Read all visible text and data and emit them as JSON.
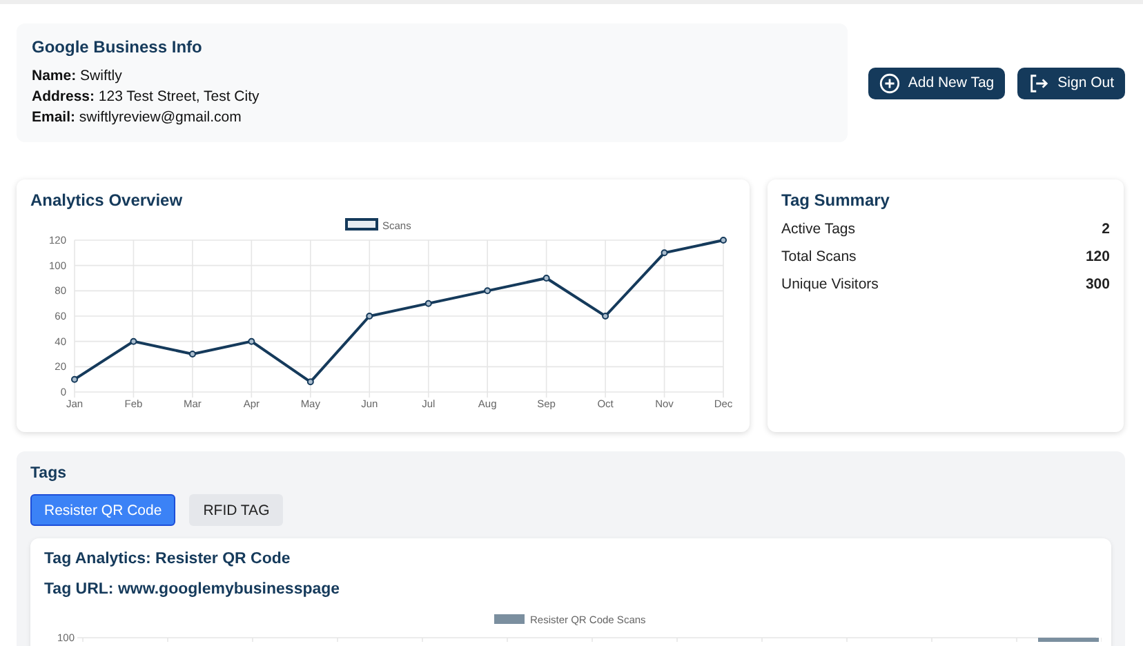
{
  "business_info": {
    "title": "Google Business Info",
    "fields": [
      {
        "label": "Name:",
        "value": "Swiftly"
      },
      {
        "label": "Address:",
        "value": "123 Test Street, Test City"
      },
      {
        "label": "Email:",
        "value": "swiftlyreview@gmail.com"
      }
    ]
  },
  "actions": [
    {
      "kind": "add",
      "label": "Add New Tag"
    },
    {
      "kind": "signout",
      "label": "Sign Out"
    }
  ],
  "analytics": {
    "title": "Analytics Overview",
    "chart_data": {
      "type": "line",
      "categories": [
        "Jan",
        "Feb",
        "Mar",
        "Apr",
        "May",
        "Jun",
        "Jul",
        "Aug",
        "Sep",
        "Oct",
        "Nov",
        "Dec"
      ],
      "series": [
        {
          "name": "Scans",
          "color": "#153a5b",
          "marker": true,
          "values": [
            10,
            40,
            30,
            40,
            8,
            60,
            70,
            80,
            90,
            60,
            110,
            120
          ]
        }
      ],
      "grid": true,
      "ylim": [
        0,
        120
      ],
      "yticks": [
        0,
        20,
        40,
        60,
        80,
        100,
        120
      ]
    }
  },
  "tag_summary": {
    "title": "Tag Summary",
    "rows": [
      {
        "label": "Active Tags",
        "value": "2"
      },
      {
        "label": "Total Scans",
        "value": "120"
      },
      {
        "label": "Unique Visitors",
        "value": "300"
      }
    ]
  },
  "tags": {
    "title": "Tags",
    "tabs": [
      {
        "label": "Resister QR Code",
        "selected": true
      },
      {
        "label": "RFID TAG",
        "selected": false
      }
    ],
    "detail": {
      "title": "Tag Analytics: Resister QR Code",
      "url": "Tag URL: www.googlemybusinesspage",
      "chart_legend": "Resister QR Code Scans",
      "chart_tick": "100"
    }
  }
}
